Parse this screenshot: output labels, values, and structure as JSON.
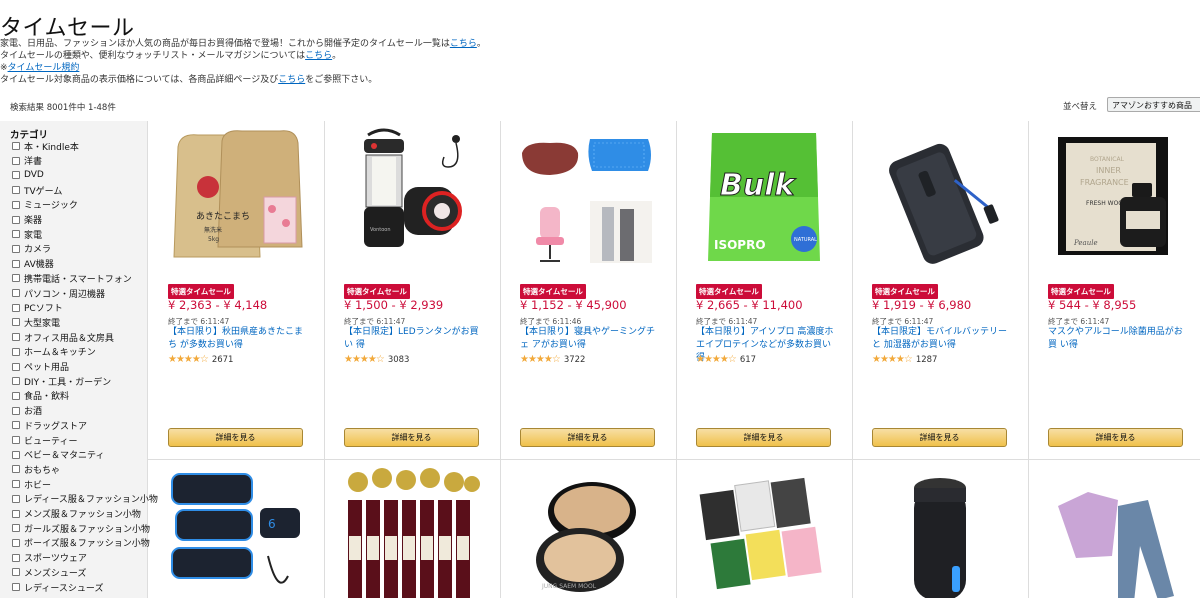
{
  "header": {
    "title": "タイムセール",
    "desc_line1": "家電、日用品、ファッションほか人気の商品が毎日お買得価格で登場！これから開催予定のタイムセール一覧は",
    "desc_line1_link": "こちら",
    "desc_line1_end": "。",
    "desc_line2": "タイムセールの種類や、便利なウォッチリスト・メールマガジンについては",
    "desc_line2_link": "こちら",
    "desc_line2_end": "。",
    "desc_line3_prefix": "※",
    "desc_line3_link": "タイムセール規約",
    "desc_line4": "タイムセール対象商品の表示価格については、各商品詳細ページ及び",
    "desc_line4_link": "こちら",
    "desc_line4_end": "をご参照下さい。"
  },
  "results": {
    "count_text": "検索結果 8001件中 1-48件",
    "sort_label": "並べ替え",
    "sort_value": "アマゾンおすすめ商品"
  },
  "sidebar": {
    "heading": "カテゴリ",
    "items": [
      "本・Kindle本",
      "洋書",
      "DVD",
      "TVゲーム",
      "ミュージック",
      "楽器",
      "家電",
      "カメラ",
      "AV機器",
      "携帯電話・スマートフォン",
      "パソコン・周辺機器",
      "PCソフト",
      "大型家電",
      "オフィス用品＆文房具",
      "ホーム＆キッチン",
      "ペット用品",
      "DIY・工具・ガーデン",
      "食品・飲料",
      "お酒",
      "ドラッグストア",
      "ビューティー",
      "ベビー＆マタニティ",
      "おもちゃ",
      "ホビー",
      "レディース服＆ファッション小物",
      "メンズ服＆ファッション小物",
      "ガールズ服＆ファッション小物",
      "ボーイズ服＆ファッション小物",
      "スポーツウェア",
      "メンズシューズ",
      "レディースシューズ"
    ]
  },
  "products": [
    {
      "badge": "特選タイムセール",
      "price": "¥ 2,363 - ¥ 4,148",
      "ends": "終了まで 6:11:47",
      "title": "【本日限り】秋田県産あきたこまち が多数お買い得",
      "stars": 4.5,
      "reviews": "2671",
      "button": "詳細を見る",
      "bag_text_1": "あきたこまち",
      "bag_text_2": "無洗米",
      "bag_text_3": "5kg"
    },
    {
      "badge": "特選タイムセール",
      "price": "¥ 1,500 - ¥ 2,939",
      "ends": "終了まで 6:11:47",
      "title": "【本日限定】LEDランタンがお買い 得",
      "stars": 4.5,
      "reviews": "3083",
      "button": "詳細を見る",
      "brand": "Vontoon"
    },
    {
      "badge": "特選タイムセール",
      "price": "¥ 1,152 - ¥ 45,900",
      "ends": "終了まで 6:11:46",
      "title": "【本日限り】寝具やゲーミングチェ アがお買い得",
      "stars": 4,
      "reviews": "3722",
      "button": "詳細を見る"
    },
    {
      "badge": "特選タイムセール",
      "price": "¥ 2,665 - ¥ 11,400",
      "ends": "終了まで 6:11:47",
      "title": "【本日限り】アイソプロ 高濃度ホ エイプロテインなどが多数お買い得",
      "stars": 4.5,
      "reviews": "617",
      "button": "詳細を見る",
      "pkg_logo": "Bulk",
      "pkg_sub": "ISOPRO",
      "pkg_tag": "NATURAL"
    },
    {
      "badge": "特選タイムセール",
      "price": "¥ 1,919 - ¥ 6,980",
      "ends": "終了まで 6:11:47",
      "title": "【本日限定】モバイルバッテリーと 加湿器がお買い得",
      "stars": 4.5,
      "reviews": "1287",
      "button": "詳細を見る"
    },
    {
      "badge": "特選タイムセール",
      "price": "¥ 544 - ¥ 8,955",
      "ends": "終了まで 6:11:47",
      "title": "マスクやアルコール除菌用品がお買 い得",
      "stars": 0,
      "reviews": "",
      "button": "詳細を見る",
      "box_text_1": "BOTANICAL",
      "box_text_2": "INNER",
      "box_text_3": "FRAGRANCE",
      "box_text_4": "FRESH WOODY",
      "box_brand": "Peaule"
    }
  ],
  "products_row2": [
    {
      "name": "ems-belt"
    },
    {
      "name": "wine-set"
    },
    {
      "name": "cushion-compact",
      "brand": "JUNG SAEM MOOL"
    },
    {
      "name": "face-masks"
    },
    {
      "name": "humidifier"
    },
    {
      "name": "pajamas"
    }
  ],
  "colors": {
    "price": "#cc0c39",
    "badge_bg": "#cc0c39",
    "link": "#0066c0",
    "star": "#f2a93b",
    "button": "#f0c14b"
  }
}
